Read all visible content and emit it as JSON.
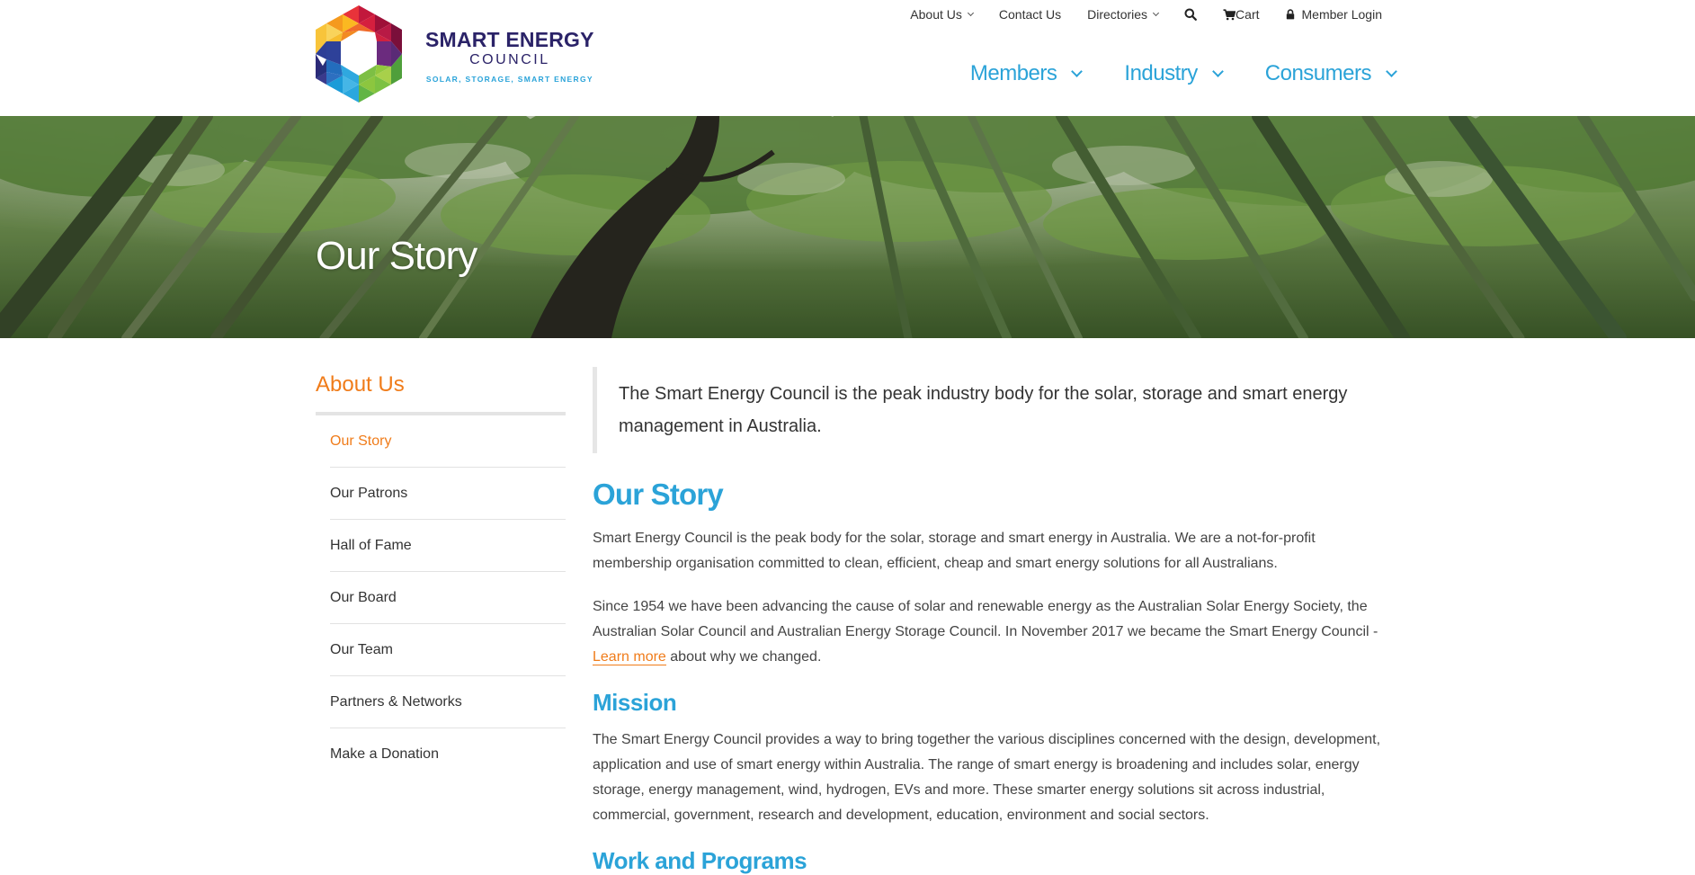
{
  "brand": {
    "name": "SMART ENERGY",
    "sub": "COUNCIL",
    "tagline": "SOLAR, STORAGE, SMART ENERGY"
  },
  "utility_nav": {
    "about": "About Us",
    "contact": "Contact Us",
    "directories": "Directories",
    "cart": "Cart",
    "login": "Member Login"
  },
  "main_nav": {
    "members": "Members",
    "industry": "Industry",
    "consumers": "Consumers"
  },
  "hero": {
    "title": "Our Story"
  },
  "sidebar": {
    "title": "About Us",
    "items": [
      {
        "label": "Our Story",
        "active": true
      },
      {
        "label": "Our Patrons"
      },
      {
        "label": "Hall of Fame"
      },
      {
        "label": "Our Board"
      },
      {
        "label": "Our Team"
      },
      {
        "label": "Partners & Networks"
      },
      {
        "label": "Make a Donation"
      }
    ]
  },
  "content": {
    "lead": "The Smart Energy Council is the peak industry body for the solar, storage and smart energy management in Australia.",
    "heading": "Our Story",
    "p1": "Smart Energy Council is the peak body for the solar, storage and smart energy in Australia. We are a not-for-profit membership organisation committed to clean, efficient, cheap and smart energy solutions for all Australians.",
    "p2_before": "Since 1954 we have been advancing the cause of solar and renewable energy as the Australian Solar Energy Society, the Australian Solar Council and Australian Energy Storage Council. In November 2017 we became the Smart Energy Council -",
    "p2_link": "Learn more",
    "p2_after": "about why we changed.",
    "mission_heading": "Mission",
    "mission_text": "The Smart Energy Council provides a way to bring together the various disciplines concerned with the design, development, application and use of smart energy within Australia. The range of smart energy is broadening and includes solar, energy storage, energy management, wind, hydrogen, EVs and more. These smarter energy solutions sit across industrial, commercial, government, research and development, education, environment and social sectors.",
    "next_heading": "Work and Programs"
  },
  "colors": {
    "accent_blue": "#2ba3d8",
    "accent_orange": "#f07c1a",
    "brand_navy": "#2b2368"
  },
  "icons": [
    "chevron-down-icon",
    "search-icon",
    "cart-icon",
    "lock-icon",
    "logo-hexagon-icon"
  ]
}
